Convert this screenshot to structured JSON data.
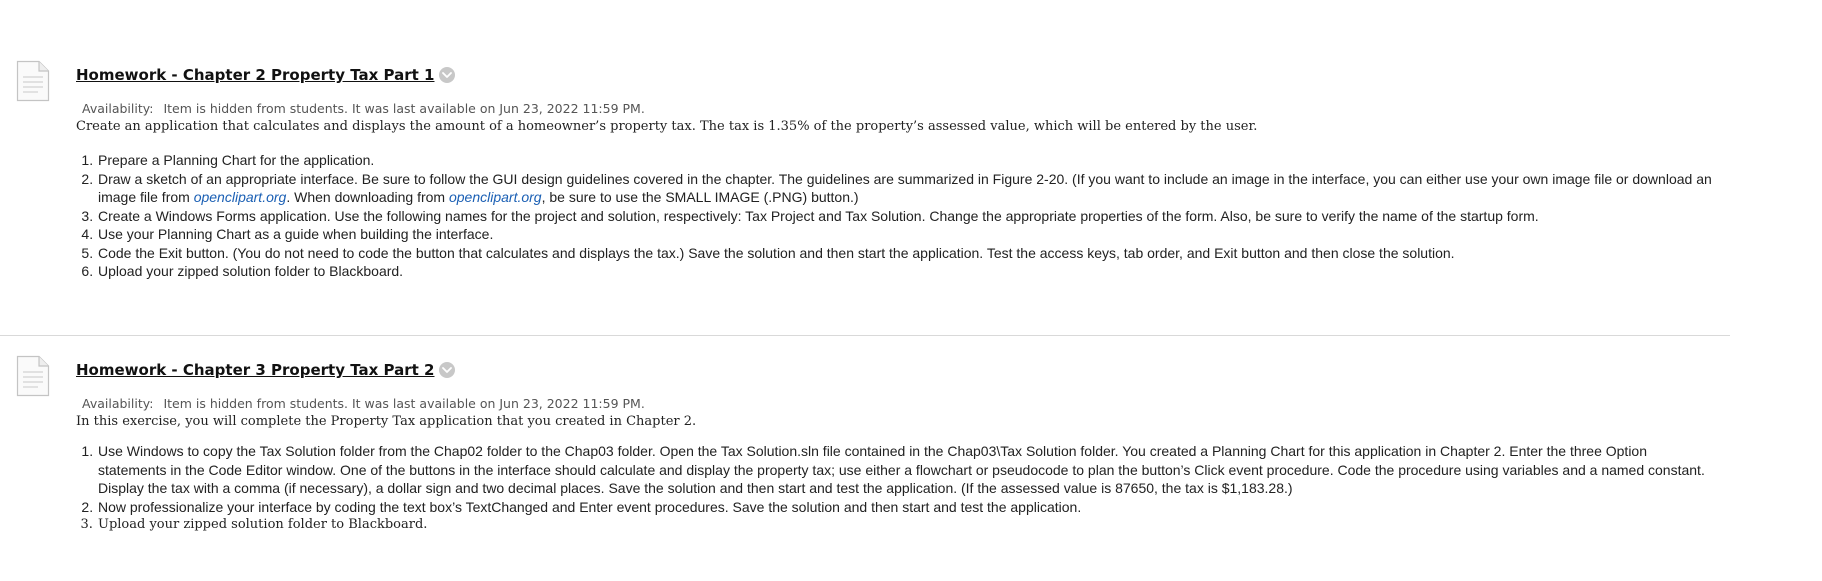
{
  "items": [
    {
      "title": "Homework - Chapter 2 Property Tax Part 1",
      "availability_label": "Availability:",
      "availability_text": "Item is hidden from students. It was last available on Jun 23, 2022 11:59 PM.",
      "description": "Create an application that calculates and displays the amount of a homeowner’s property tax. The tax is 1.35% of the property’s assessed value, which will be entered by the user.",
      "steps": {
        "s1": "Prepare a Planning Chart for the application.",
        "s2_a": "Draw a sketch of an appropriate interface. Be sure to follow the GUI design guidelines covered in the chapter. The guidelines are summarized in Figure 2-20. (If you want to include an image in the interface, you can either use your own image file or download an image file from ",
        "s2_link1": "openclipart.org",
        "s2_b": ". When downloading from ",
        "s2_link2": "openclipart.org",
        "s2_c": ", be sure to use the SMALL IMAGE (.PNG) button.)",
        "s3": "Create a Windows Forms application. Use the following names for the project and solution, respectively: Tax Project and Tax Solution. Change the appropriate properties of the form. Also, be sure to verify the name of the startup form.",
        "s4": "Use your Planning Chart as a guide when building the interface.",
        "s5": "Code the Exit button. (You do not need to code the button that calculates and displays the tax.) Save the solution and then start the application. Test the access keys, tab order, and Exit button and then close the solution.",
        "s6": "Upload your zipped solution folder to Blackboard."
      }
    },
    {
      "title": "Homework - Chapter 3 Property Tax Part 2",
      "availability_label": "Availability:",
      "availability_text": "Item is hidden from students. It was last available on Jun 23, 2022 11:59 PM.",
      "description": "In this exercise, you will complete the Property Tax application that you created in Chapter 2.",
      "steps": {
        "s1": "Use Windows to copy the Tax Solution folder from the Chap02 folder to the Chap03 folder. Open the Tax Solution.sln file contained in the Chap03\\Tax Solution folder. You created a Planning Chart for this application in Chapter 2. Enter the three Option statements in the Code Editor window. One of the buttons in the interface should calculate and display the property tax; use either a flowchart or pseudocode to plan the button’s Click event procedure. Code the procedure using variables and a named constant. Display the tax with a comma (if necessary), a dollar sign and two decimal places. Save the solution and then start and test the application. (If the assessed value is 87650, the tax is $1,183.28.)",
        "s2": "Now professionalize your interface by coding the text box’s TextChanged and Enter event procedures. Save the solution and then start and test the application.",
        "s3": "Upload your zipped solution folder to Blackboard."
      }
    }
  ],
  "icons": {
    "item_icon": "document-icon",
    "menu_icon": "chevron-down-icon"
  },
  "colors": {
    "link": "#1a5fb4",
    "divider": "#d9d9d9",
    "menu_circle": "#c8c8c8"
  }
}
